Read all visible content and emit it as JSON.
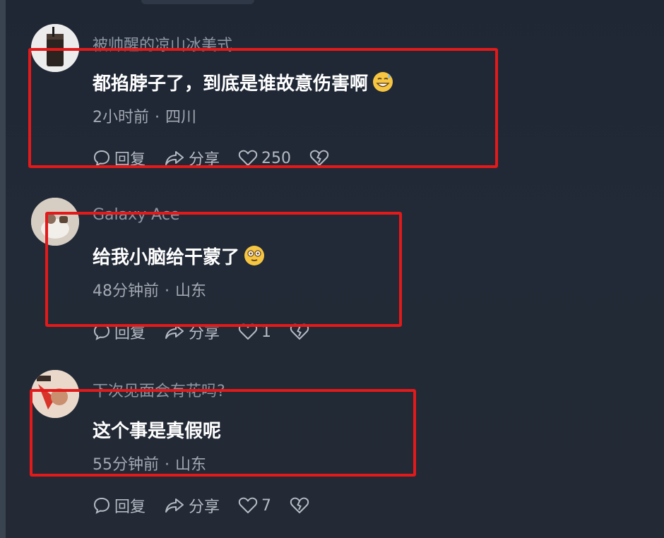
{
  "comments": [
    {
      "username": "被帅醒的凉山冰美式",
      "text": "都掐脖子了，到底是谁故意伤害啊",
      "emoji_icon": "grinning-sweat-emoji",
      "time": "2小时前",
      "location": "四川",
      "reply_label": "回复",
      "share_label": "分享",
      "likes": "250"
    },
    {
      "username": "Galaxy Ace",
      "text": "给我小脑给干蒙了",
      "emoji_icon": "dizzy-face-emoji",
      "time": "48分钟前",
      "location": "山东",
      "reply_label": "回复",
      "share_label": "分享",
      "likes": "1"
    },
    {
      "username": "下次见面会有花吗?",
      "text": "这个事是真假呢",
      "time": "55分钟前",
      "location": "山东",
      "reply_label": "回复",
      "share_label": "分享",
      "likes": "7"
    }
  ],
  "meta_separator": "·",
  "colors": {
    "highlight": "#e3191a",
    "background": "#222a37",
    "secondary_text": "#a3a9b3"
  }
}
